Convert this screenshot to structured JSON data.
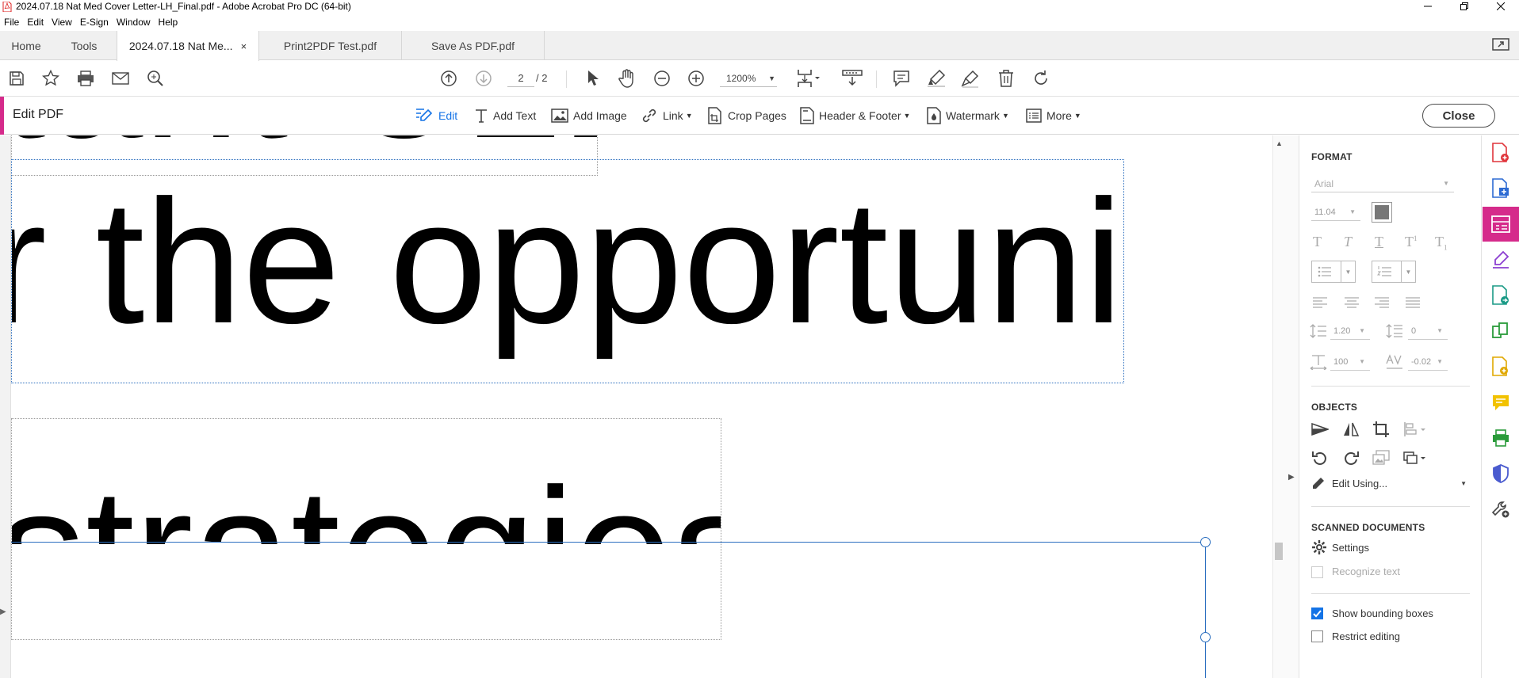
{
  "window": {
    "title": "2024.07.18 Nat Med Cover Letter-LH_Final.pdf - Adobe Acrobat Pro DC (64-bit)"
  },
  "menu": [
    "File",
    "Edit",
    "View",
    "E-Sign",
    "Window",
    "Help"
  ],
  "tabs": {
    "home": "Home",
    "tools": "Tools",
    "docs": [
      {
        "label": "2024.07.18 Nat Me...",
        "active": true,
        "close": "×"
      },
      {
        "label": "Print2PDF Test.pdf",
        "active": false
      },
      {
        "label": "Save As PDF.pdf",
        "active": false
      }
    ]
  },
  "toolbar": {
    "page_current": "2",
    "page_total": "/ 2",
    "zoom": "1200%"
  },
  "edit_bar": {
    "label": "Edit PDF",
    "tools": [
      "Edit",
      "Add Text",
      "Add Image",
      "Link",
      "Crop Pages",
      "Header & Footer",
      "Watermark",
      "More"
    ],
    "close": "Close"
  },
  "document": {
    "line1": "tant CLL",
    "line2": "r the opportunity",
    "line3": "strategies"
  },
  "panel": {
    "format": {
      "title": "FORMAT",
      "font": "Arial",
      "size": "11.04",
      "line_spacing": "1.20",
      "para_spacing": "0",
      "horiz_scale": "100",
      "char_spacing": "-0.02"
    },
    "objects": {
      "title": "OBJECTS",
      "edit_using": "Edit Using..."
    },
    "scanned": {
      "title": "SCANNED DOCUMENTS",
      "settings": "Settings",
      "recognize": "Recognize text"
    },
    "show_bounding_boxes": "Show bounding boxes",
    "restrict_editing": "Restrict editing"
  },
  "colors": {
    "accent": "#d52b8b",
    "blue": "#1473e6"
  }
}
